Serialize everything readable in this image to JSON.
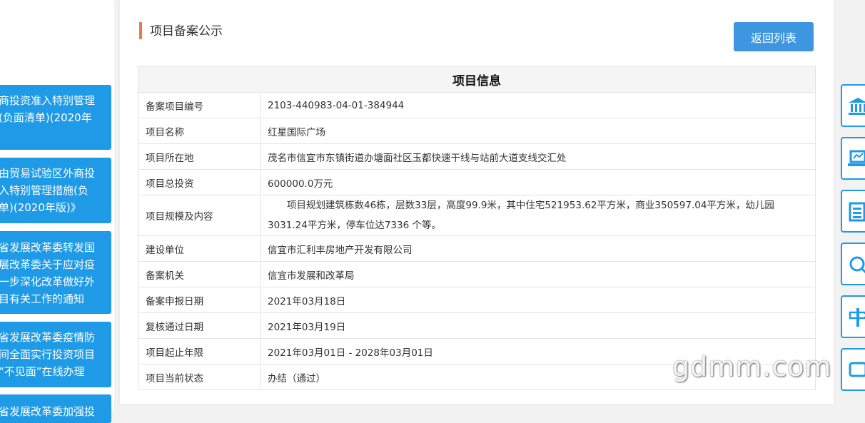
{
  "left_news": [
    {
      "text": "商投资准入特别管理\n(负面清单)(2020年"
    },
    {
      "text": "由贸易试验区外商投\n入特别管理措施(负\n单)(2020年版)》"
    },
    {
      "text": "省发展改革委转发国\n展改革委关于应对疫\n一步深化改革做好外\n目有关工作的通知"
    },
    {
      "text": "省发展改革委疫情防\n间全面实行投资项目\n“不见面”在线办理"
    },
    {
      "text": "省发展改革委加强投"
    }
  ],
  "page": {
    "heading": "项目备案公示",
    "back_button": "返回列表"
  },
  "table": {
    "title": "项目信息",
    "rows": [
      {
        "label": "备案项目编号",
        "value": "2103-440983-04-01-384944"
      },
      {
        "label": "项目名称",
        "value": "红星国际广场"
      },
      {
        "label": "项目所在地",
        "value": "茂名市信宜市东镇街道办塘面社区玉都快速干线与站前大道支线交汇处"
      },
      {
        "label": "项目总投资",
        "value": "600000.0万元"
      },
      {
        "label": "项目规模及内容",
        "value": "项目规划建筑栋数46栋，层数33层，高度99.9米，其中住宅521953.62平方米，商业350597.04平方米，幼儿园3031.24平方米，停车位达7336 个等。"
      },
      {
        "label": "建设单位",
        "value": "信宜市汇利丰房地产开发有限公司"
      },
      {
        "label": "备案机关",
        "value": "信宜市发展和改革局"
      },
      {
        "label": "备案申报日期",
        "value": "2021年03月18日"
      },
      {
        "label": "复核通过日期",
        "value": "2021年03月19日"
      },
      {
        "label": "项目起止年限",
        "value": "2021年03月01日 - 2028年03月01日"
      },
      {
        "label": "项目当前状态",
        "value": "办结（通过）"
      }
    ]
  },
  "watermark": "gdmm.com",
  "right_icons": [
    "bank-icon",
    "laptop-icon",
    "document-stack-icon",
    "search-icon",
    "signpost-icon",
    "chat-icon"
  ],
  "colors": {
    "accent_blue": "#1e9ae6",
    "button_blue": "#3e95e0",
    "heading_bar": "#f0764f"
  }
}
